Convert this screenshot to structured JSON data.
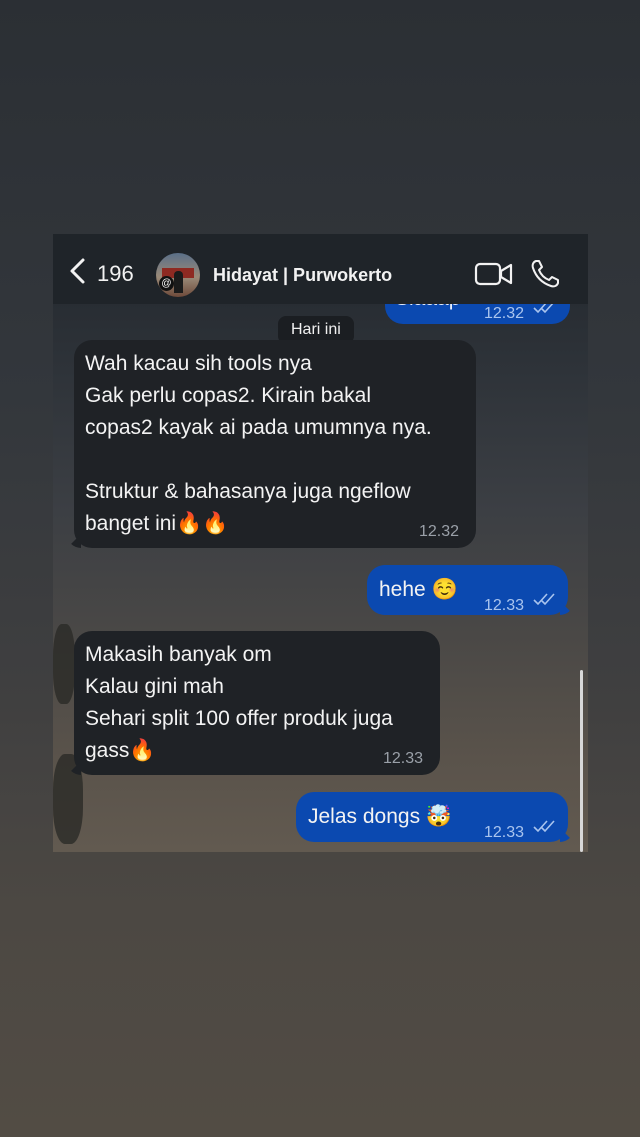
{
  "header": {
    "back_count": "196",
    "contact_name": "Hidayat | Purwokerto",
    "avatar_badge": "@"
  },
  "date_chip": "Hari ini",
  "messages": [
    {
      "direction": "out",
      "text": "Siaaap",
      "time": "12.32",
      "status": "read"
    },
    {
      "direction": "in",
      "lines": [
        "Wah kacau sih tools nya",
        "Gak perlu copas2. Kirain bakal",
        "copas2 kayak ai pada umumnya nya.",
        "",
        "Struktur & bahasanya juga ngeflow",
        "banget ini🔥🔥"
      ],
      "time": "12.32"
    },
    {
      "direction": "out",
      "text": "hehe ☺️",
      "time": "12.33",
      "status": "read"
    },
    {
      "direction": "in",
      "lines": [
        "Makasih banyak om",
        "Kalau gini mah",
        "Sehari split 100 offer produk juga",
        "gass🔥"
      ],
      "time": "12.33"
    },
    {
      "direction": "out",
      "text": "Jelas dongs 🤯",
      "time": "12.33",
      "status": "read"
    }
  ],
  "colors": {
    "outgoing_bubble": "#0b49b0",
    "incoming_bubble": "#1f2226",
    "header_bg": "#1f2429"
  },
  "icons": [
    "back-chevron-icon",
    "video-call-icon",
    "phone-call-icon",
    "read-ticks-icon"
  ]
}
